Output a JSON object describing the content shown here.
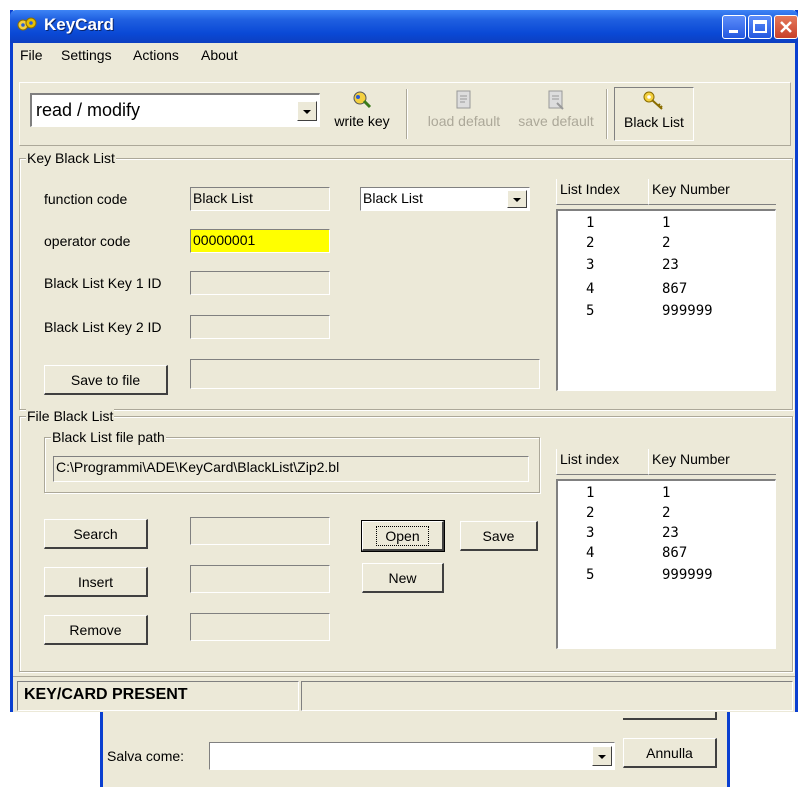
{
  "window": {
    "title": "KeyCard"
  },
  "menu": [
    {
      "label": "File",
      "accel": "F"
    },
    {
      "label": "Settings",
      "accel": "S"
    },
    {
      "label": "Actions",
      "accel": "A"
    },
    {
      "label": "About",
      "accel": "b"
    }
  ],
  "toolbar": {
    "mode_value": "read / modify",
    "write_key": "write key",
    "load_default": "load default",
    "save_default": "save default",
    "black_list": "Black List"
  },
  "key_black_list": {
    "title": "Key Black List",
    "function_code_label": "function code",
    "function_code_value": "Black List",
    "function_select_value": "Black List",
    "operator_code_label": "operator code",
    "operator_code_value": "00000001",
    "key1_label": "Black List Key 1 ID",
    "key1_value": "",
    "key2_label": "Black List Key 2 ID",
    "key2_value": "",
    "save_button": "Save to file",
    "save_path_value": "",
    "list": {
      "col1": "List Index",
      "col2": "Key Number",
      "rows": [
        {
          "index": "1",
          "key": "1"
        },
        {
          "index": "2",
          "key": "2"
        },
        {
          "index": "3",
          "key": "23"
        },
        {
          "index": "4",
          "key": "867"
        },
        {
          "index": "5",
          "key": "999999"
        }
      ]
    }
  },
  "file_black_list": {
    "title": "File Black List",
    "path_group_title": "Black List file path",
    "path_value": "C:\\Programmi\\ADE\\KeyCard\\BlackList\\Zip2.bl",
    "search_button": "Search",
    "insert_button": "Insert",
    "remove_button": "Remove",
    "open_button": "Open",
    "open_accel": "O",
    "save_button": "Save",
    "new_button": "New",
    "list": {
      "col1": "List index",
      "col2": "Key Number",
      "rows": [
        {
          "index": "1",
          "key": "1"
        },
        {
          "index": "2",
          "key": "2"
        },
        {
          "index": "3",
          "key": "23"
        },
        {
          "index": "4",
          "key": "867"
        },
        {
          "index": "5",
          "key": "999999"
        }
      ]
    }
  },
  "status": {
    "text": "KEY/CARD PRESENT"
  },
  "save_dialog": {
    "label": "Salva come:",
    "accel": "v",
    "value": "",
    "cancel_button": "Annulla"
  }
}
